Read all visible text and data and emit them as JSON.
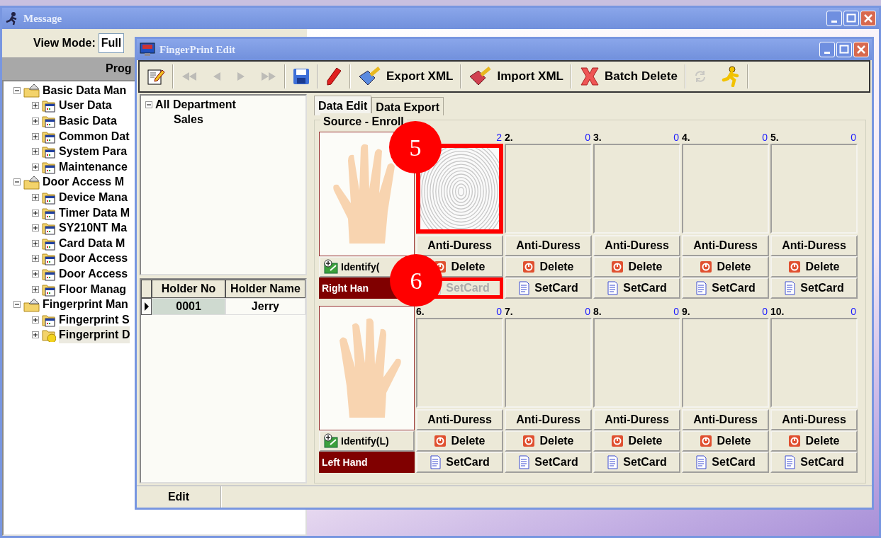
{
  "message_window": {
    "title": "Message",
    "view_mode": {
      "label": "View Mode:",
      "value": "Full"
    },
    "panel_header": "Prog",
    "tree": [
      {
        "label": "Basic Data Man",
        "expanded": true,
        "children": [
          {
            "label": "User Data",
            "expanded": false,
            "selected": false
          },
          {
            "label": "Basic Data",
            "expanded": false,
            "selected": false
          },
          {
            "label": "Common Dat",
            "expanded": false,
            "selected": false
          },
          {
            "label": "System Para",
            "expanded": false,
            "selected": false
          },
          {
            "label": "Maintenance",
            "expanded": false,
            "selected": false
          }
        ]
      },
      {
        "label": "Door Access M",
        "expanded": true,
        "children": [
          {
            "label": "Device Mana",
            "expanded": false,
            "selected": false
          },
          {
            "label": "Timer Data M",
            "expanded": false,
            "selected": false
          },
          {
            "label": "SY210NT Ma",
            "expanded": false,
            "selected": false
          },
          {
            "label": "Card Data M",
            "expanded": false,
            "selected": false
          },
          {
            "label": "Door Access",
            "expanded": false,
            "selected": false
          },
          {
            "label": "Door Access",
            "expanded": false,
            "selected": false
          },
          {
            "label": "Floor Manag",
            "expanded": false,
            "selected": false
          }
        ]
      },
      {
        "label": "Fingerprint Man",
        "expanded": true,
        "children": [
          {
            "label": "Fingerprint S",
            "expanded": false,
            "selected": false
          },
          {
            "label": "Fingerprint D",
            "expanded": false,
            "selected": true
          }
        ]
      }
    ]
  },
  "fingerprint_window": {
    "title": "FingerPrint Edit",
    "toolbar": [
      {
        "kind": "button",
        "disabled": false
      },
      {
        "kind": "separator"
      },
      {
        "kind": "button",
        "disabled": true
      },
      {
        "kind": "button",
        "disabled": true
      },
      {
        "kind": "button",
        "disabled": true
      },
      {
        "kind": "button",
        "disabled": true
      },
      {
        "kind": "separator"
      },
      {
        "kind": "button",
        "disabled": false
      },
      {
        "kind": "separator"
      },
      {
        "kind": "button",
        "disabled": false
      },
      {
        "kind": "separator"
      },
      {
        "kind": "button",
        "disabled": false,
        "label": "Export XML"
      },
      {
        "kind": "separator"
      },
      {
        "kind": "button",
        "disabled": false,
        "label": "Import XML"
      },
      {
        "kind": "separator"
      },
      {
        "kind": "button",
        "disabled": false,
        "label": "Batch Delete"
      },
      {
        "kind": "separator"
      },
      {
        "kind": "button",
        "disabled": true
      },
      {
        "kind": "button",
        "disabled": false
      },
      {
        "kind": "separator"
      }
    ],
    "department_tree": [
      {
        "label": "All Department",
        "expanded": true,
        "children": [
          {
            "label": "Sales"
          }
        ]
      }
    ],
    "holder_table": {
      "columns": [
        "Holder No",
        "Holder Name"
      ],
      "rows": [
        {
          "cells": [
            "0001",
            "Jerry"
          ],
          "selected": true
        }
      ]
    },
    "tabs": [
      {
        "label": "Data Edit",
        "selected": true
      },
      {
        "label": "Data Export",
        "selected": false
      }
    ],
    "group_title": "Source - Enroll",
    "hands": [
      {
        "kind": "right",
        "identify": "Identify(",
        "label": "Right Han",
        "callout": "6",
        "fingers": [
          {
            "count": "2",
            "has_image": true,
            "callout": "5",
            "anti_duress": "Anti-Duress",
            "delete": "Delete",
            "setcard": "SetCard",
            "setcard_disabled": true,
            "setcard_highlighted": true
          },
          {
            "number": "2.",
            "count": "0",
            "has_image": false,
            "anti_duress": "Anti-Duress",
            "delete": "Delete",
            "setcard": "SetCard",
            "setcard_disabled": false,
            "setcard_highlighted": false
          },
          {
            "number": "3.",
            "count": "0",
            "has_image": false,
            "anti_duress": "Anti-Duress",
            "delete": "Delete",
            "setcard": "SetCard",
            "setcard_disabled": false,
            "setcard_highlighted": false
          },
          {
            "number": "4.",
            "count": "0",
            "has_image": false,
            "anti_duress": "Anti-Duress",
            "delete": "Delete",
            "setcard": "SetCard",
            "setcard_disabled": false,
            "setcard_highlighted": false
          },
          {
            "number": "5.",
            "count": "0",
            "has_image": false,
            "anti_duress": "Anti-Duress",
            "delete": "Delete",
            "setcard": "SetCard",
            "setcard_disabled": false,
            "setcard_highlighted": false
          }
        ]
      },
      {
        "kind": "left",
        "identify": "Identify(L)",
        "label": "Left Hand",
        "fingers": [
          {
            "number": "6.",
            "count": "0",
            "has_image": false,
            "anti_duress": "Anti-Duress",
            "delete": "Delete",
            "setcard": "SetCard",
            "setcard_disabled": false,
            "setcard_highlighted": false
          },
          {
            "number": "7.",
            "count": "0",
            "has_image": false,
            "anti_duress": "Anti-Duress",
            "delete": "Delete",
            "setcard": "SetCard",
            "setcard_disabled": false,
            "setcard_highlighted": false
          },
          {
            "number": "8.",
            "count": "0",
            "has_image": false,
            "anti_duress": "Anti-Duress",
            "delete": "Delete",
            "setcard": "SetCard",
            "setcard_disabled": false,
            "setcard_highlighted": false
          },
          {
            "number": "9.",
            "count": "0",
            "has_image": false,
            "anti_duress": "Anti-Duress",
            "delete": "Delete",
            "setcard": "SetCard",
            "setcard_disabled": false,
            "setcard_highlighted": false
          },
          {
            "number": "10.",
            "count": "0",
            "has_image": false,
            "anti_duress": "Anti-Duress",
            "delete": "Delete",
            "setcard": "SetCard",
            "setcard_disabled": false,
            "setcard_highlighted": false
          }
        ]
      }
    ],
    "status_bar": [
      "Edit"
    ]
  }
}
